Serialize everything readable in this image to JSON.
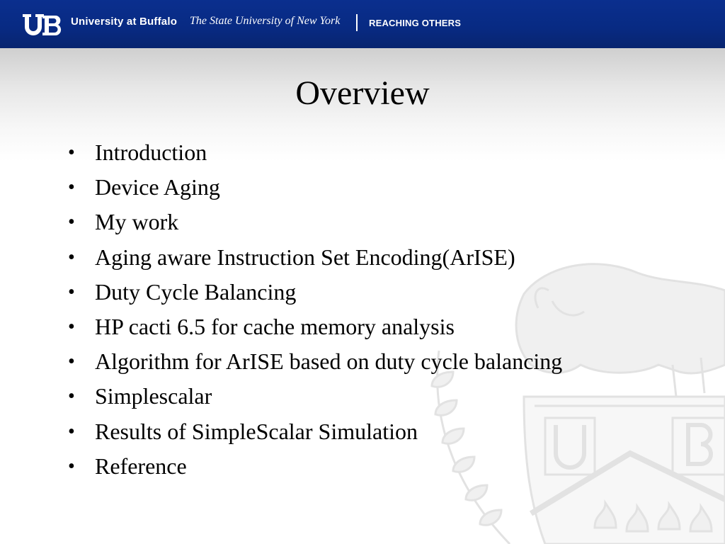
{
  "header": {
    "logo_text": "UB",
    "university": "University at Buffalo",
    "system": "The State University of New York",
    "tagline": "REACHING OTHERS",
    "colors": {
      "banner": "#0a2f8e",
      "text": "#ffffff"
    }
  },
  "slide": {
    "title": "Overview",
    "bullet_glyph": "•",
    "items": [
      "Introduction",
      "Device Aging",
      "My work",
      "Aging aware Instruction Set Encoding(ArISE)",
      "Duty Cycle Balancing",
      "HP cacti 6.5 for cache memory analysis",
      "Algorithm for ArISE based on duty cycle balancing",
      "Simplescalar",
      "Results of SimpleScalar Simulation",
      "Reference"
    ]
  },
  "watermark": {
    "description_icon": "buffalo-crest-icon",
    "crest_letters": [
      "U",
      "B"
    ]
  }
}
